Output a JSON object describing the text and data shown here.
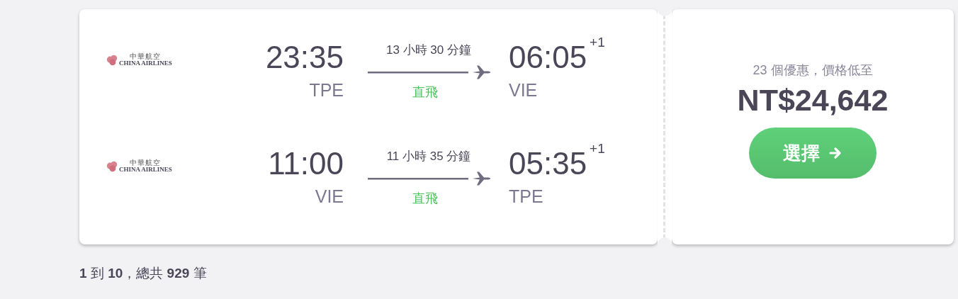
{
  "itinerary": {
    "legs": [
      {
        "airline": {
          "name_zh": "中華航空",
          "name_en": "CHINA AIRLINES"
        },
        "depart_time": "23:35",
        "depart_airport": "TPE",
        "duration": "13 小時 30 分鐘",
        "stops": "直飛",
        "arrive_time": "06:05",
        "day_offset": "+1",
        "arrive_airport": "VIE"
      },
      {
        "airline": {
          "name_zh": "中華航空",
          "name_en": "CHINA AIRLINES"
        },
        "depart_time": "11:00",
        "depart_airport": "VIE",
        "duration": "11 小時 35 分鐘",
        "stops": "直飛",
        "arrive_time": "05:35",
        "day_offset": "+1",
        "arrive_airport": "TPE"
      }
    ]
  },
  "offer": {
    "deals": "23 個優惠，價格低至",
    "price": "NT$24,642",
    "button": "選擇"
  },
  "pagination": "**1** 到 **10**，總共 **929** 筆"
}
